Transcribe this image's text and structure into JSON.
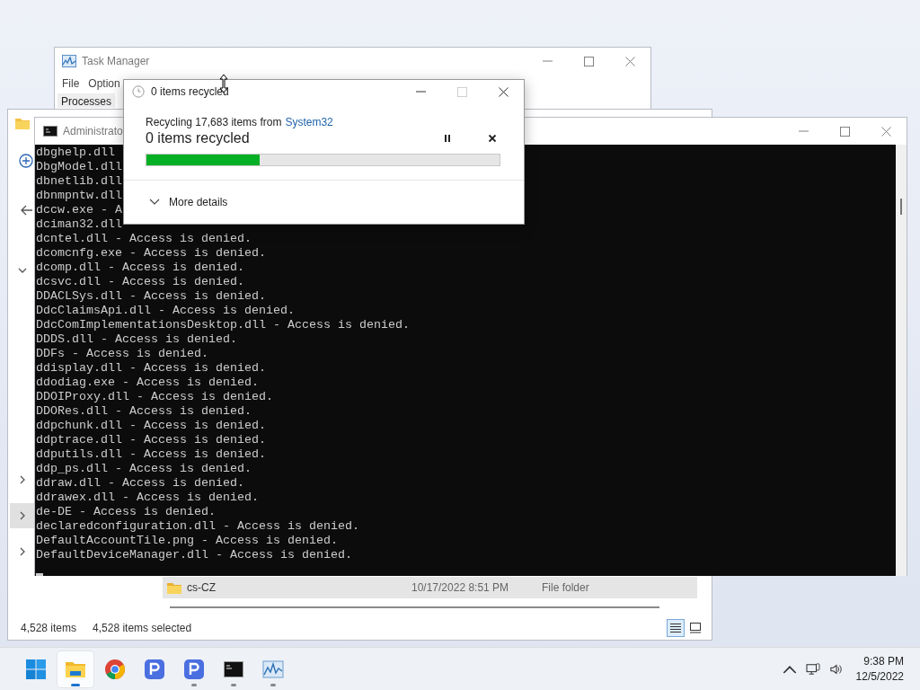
{
  "task_manager": {
    "title": "Task Manager",
    "menu": [
      "File",
      "Option"
    ],
    "tabs": [
      {
        "label": "Processes",
        "selected": true
      }
    ]
  },
  "explorer": {
    "nav_items": [
      {
        "expanded": true,
        "selected": false
      },
      {
        "expanded": false,
        "selected": false
      },
      {
        "expanded": false,
        "selected": true
      },
      {
        "expanded": false,
        "selected": false
      }
    ],
    "files": [
      {
        "name": "cs-CZ",
        "date": "10/17/2022 8:51 PM",
        "type": "File folder",
        "selected": true
      }
    ],
    "status_count": "4,528 items",
    "status_selected": "4,528 items selected",
    "views": [
      {
        "kind": "details",
        "selected": true
      },
      {
        "kind": "tiles",
        "selected": false
      }
    ]
  },
  "console": {
    "title": "Administrato",
    "lines": [
      "dbghelp.dll",
      "DbgModel.dll",
      "dbnetlib.dll",
      "dbnmpntw.dll",
      "dccw.exe - A",
      "dciman32.dll",
      "dcntel.dll - Access is denied.",
      "dcomcnfg.exe - Access is denied.",
      "dcomp.dll - Access is denied.",
      "dcsvc.dll - Access is denied.",
      "DDACLSys.dll - Access is denied.",
      "DdcClaimsApi.dll - Access is denied.",
      "DdcComImplementationsDesktop.dll - Access is denied.",
      "DDDS.dll - Access is denied.",
      "DDFs - Access is denied.",
      "ddisplay.dll - Access is denied.",
      "ddodiag.exe - Access is denied.",
      "DDOIProxy.dll - Access is denied.",
      "DDORes.dll - Access is denied.",
      "ddpchunk.dll - Access is denied.",
      "ddptrace.dll - Access is denied.",
      "ddputils.dll - Access is denied.",
      "ddp_ps.dll - Access is denied.",
      "ddraw.dll - Access is denied.",
      "ddrawex.dll - Access is denied.",
      "de-DE - Access is denied.",
      "declaredconfiguration.dll - Access is denied.",
      "DefaultAccountTile.png - Access is denied.",
      "DefaultDeviceManager.dll - Access is denied."
    ]
  },
  "dialog": {
    "title": "0 items recycled",
    "source_prefix": "Recycling 17,683 items from",
    "source_link": "System32",
    "progress_text": "0 items recycled",
    "level": 0.32,
    "details_label": "More details",
    "details_expanded": false
  },
  "taskbar": {
    "apps": [
      {
        "kind": "start",
        "running": false,
        "active": false
      },
      {
        "kind": "explorer",
        "running": true,
        "active": true
      },
      {
        "kind": "chrome",
        "running": false,
        "active": false
      },
      {
        "kind": "p-app",
        "running": false,
        "active": false
      },
      {
        "kind": "p-app",
        "running": true,
        "active": false
      },
      {
        "kind": "terminal",
        "running": true,
        "active": false
      },
      {
        "kind": "monitor",
        "running": true,
        "active": false
      }
    ],
    "time": "9:38 PM",
    "date": "12/5/2022"
  }
}
